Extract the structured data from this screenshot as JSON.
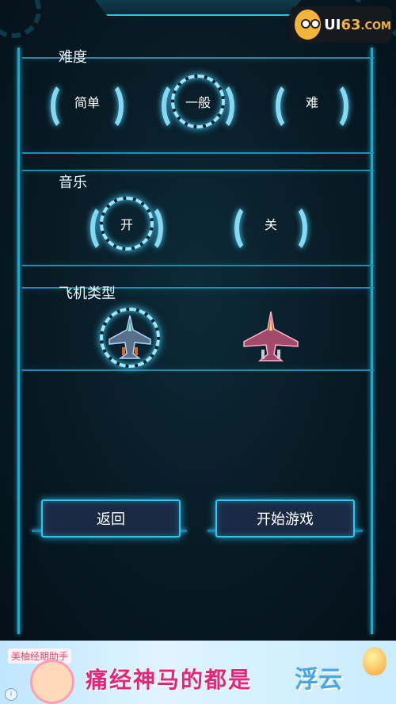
{
  "logo": {
    "prefix": "UI",
    "number": "63",
    "suffix": ".COM"
  },
  "difficulty": {
    "title": "难度",
    "options": [
      {
        "label": "简单",
        "selected": false
      },
      {
        "label": "一般",
        "selected": true
      },
      {
        "label": "难",
        "selected": false
      }
    ]
  },
  "music": {
    "title": "音乐",
    "options": [
      {
        "label": "开",
        "selected": true
      },
      {
        "label": "关",
        "selected": false
      }
    ]
  },
  "plane_type": {
    "title": "飞机类型",
    "options": [
      {
        "icon": "fighter-jet-blue-icon",
        "selected": true
      },
      {
        "icon": "fighter-jet-red-icon",
        "selected": false
      }
    ]
  },
  "buttons": {
    "back": "返回",
    "start": "开始游戏"
  },
  "ad": {
    "app_name": "美柚经期助手",
    "slogan": "痛经神马的都是",
    "highlight": "浮云",
    "info": "i"
  },
  "colors": {
    "accent": "#36c4ea",
    "button_bg": "#1a2a45",
    "ad_pink": "#e4257a"
  }
}
